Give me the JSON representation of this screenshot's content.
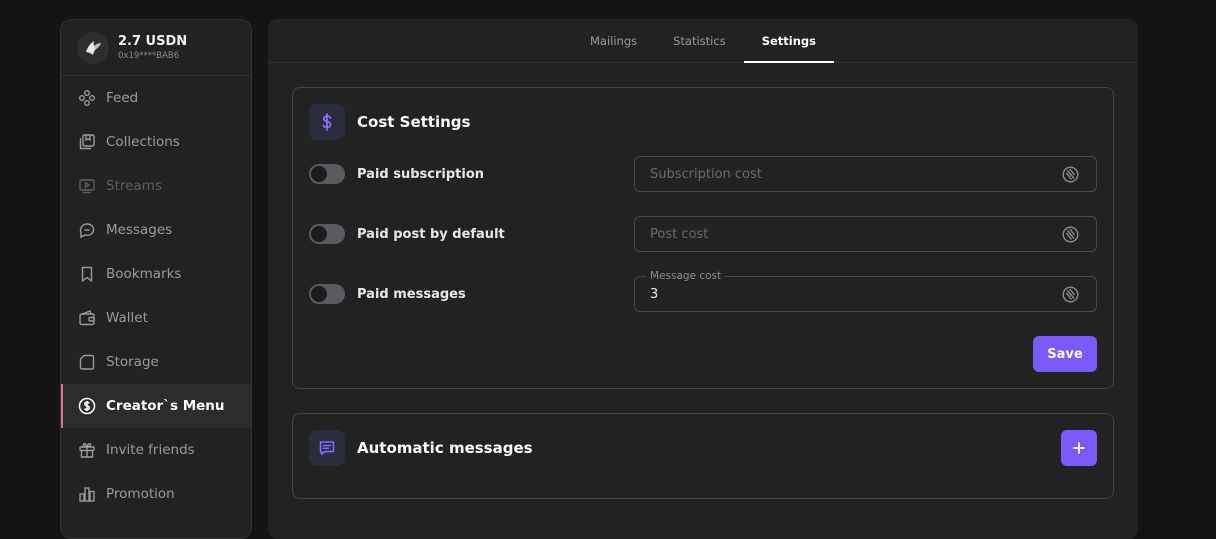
{
  "account": {
    "balance": "2.7 USDN",
    "address": "0x19****BAB6"
  },
  "sidebar": {
    "items": [
      {
        "label": "Feed",
        "icon": "feed-icon"
      },
      {
        "label": "Collections",
        "icon": "collections-icon"
      },
      {
        "label": "Streams",
        "icon": "streams-icon",
        "disabled": true
      },
      {
        "label": "Messages",
        "icon": "messages-icon"
      },
      {
        "label": "Bookmarks",
        "icon": "bookmark-icon"
      },
      {
        "label": "Wallet",
        "icon": "wallet-icon"
      },
      {
        "label": "Storage",
        "icon": "storage-icon"
      },
      {
        "label": "Creator`s Menu",
        "icon": "dollar-circle-icon",
        "active": true
      },
      {
        "label": "Invite friends",
        "icon": "gift-icon"
      },
      {
        "label": "Promotion",
        "icon": "bar-chart-icon"
      }
    ]
  },
  "tabs": [
    {
      "label": "Mailings"
    },
    {
      "label": "Statistics"
    },
    {
      "label": "Settings",
      "active": true
    }
  ],
  "cost_settings": {
    "title": "Cost Settings",
    "icon": "dollar-icon",
    "rows": [
      {
        "label": "Paid subscription",
        "toggle_on": false,
        "placeholder": "Subscription cost",
        "value": ""
      },
      {
        "label": "Paid post by default",
        "toggle_on": false,
        "placeholder": "Post cost",
        "value": ""
      },
      {
        "label": "Paid messages",
        "toggle_on": false,
        "field_label": "Message cost",
        "value": "3"
      }
    ],
    "save_label": "Save"
  },
  "automatic_messages": {
    "title": "Automatic messages",
    "icon": "chat-icon",
    "add_icon": "plus-icon"
  },
  "colors": {
    "accent": "#7a5af8",
    "active_marker": "#e06a8e",
    "background": "#141414",
    "panel": "#222222"
  }
}
